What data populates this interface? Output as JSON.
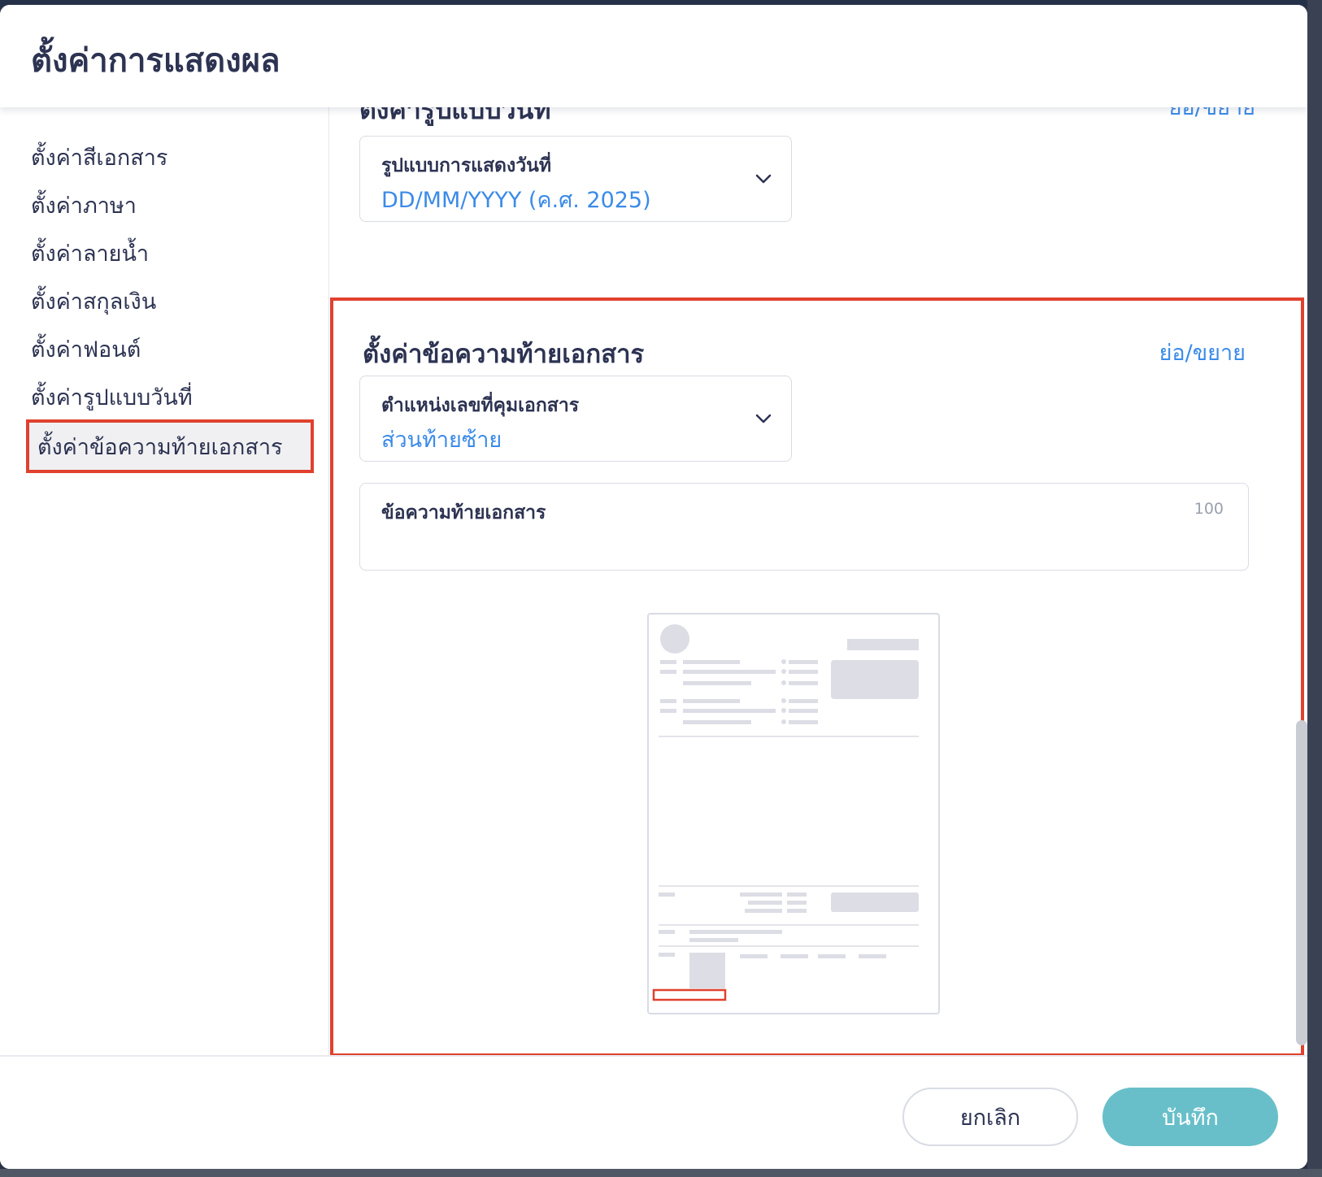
{
  "dialog": {
    "title": "ตั้งค่าการแสดงผล"
  },
  "sidebar": {
    "items": [
      {
        "label": "ตั้งค่าสีเอกสาร"
      },
      {
        "label": "ตั้งค่าภาษา"
      },
      {
        "label": "ตั้งค่าลายน้ำ"
      },
      {
        "label": "ตั้งค่าสกุลเงิน"
      },
      {
        "label": "ตั้งค่าฟอนต์"
      },
      {
        "label": "ตั้งค่ารูปแบบวันที่"
      },
      {
        "label": "ตั้งค่าข้อความท้ายเอกสาร",
        "active": true
      }
    ]
  },
  "date_format_section": {
    "heading": "ตั้งค่ารูปแบบวันที่",
    "toggle_label": "ย่อ/ขยาย",
    "field_label": "รูปแบบการแสดงวันที่",
    "field_value": "DD/MM/YYYY (ค.ศ. 2025)"
  },
  "footer_text_section": {
    "heading": "ตั้งค่าข้อความท้ายเอกสาร",
    "toggle_label": "ย่อ/ขยาย",
    "position_field": {
      "label": "ตำแหน่งเลขที่คุมเอกสาร",
      "value": "ส่วนท้ายซ้าย"
    },
    "text_field": {
      "label": "ข้อความท้ายเอกสาร",
      "max_length": "100",
      "value": ""
    }
  },
  "actions": {
    "cancel_label": "ยกเลิก",
    "save_label": "บันทึก"
  },
  "colors": {
    "accent_link": "#3b8be8",
    "highlight_border": "#e0412f",
    "primary_button": "#68bfc9",
    "title_text": "#2d3352"
  }
}
